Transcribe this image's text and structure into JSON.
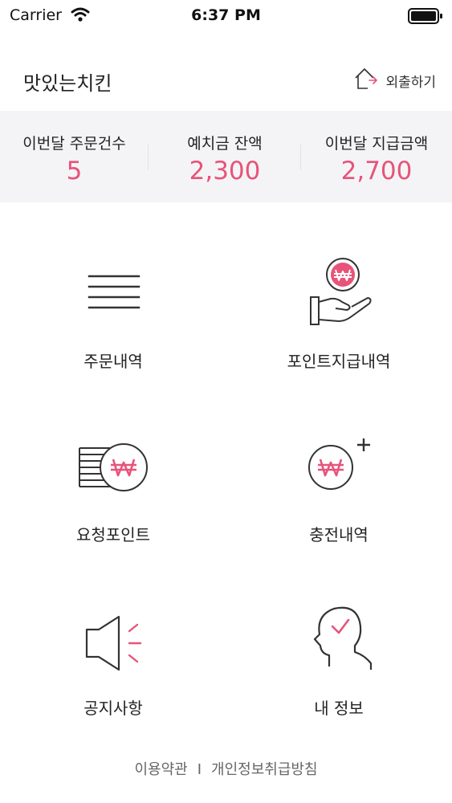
{
  "status_bar": {
    "carrier": "Carrier",
    "time": "6:37 PM"
  },
  "header": {
    "store_name": "맛있는치킨",
    "logout_label": "외출하기"
  },
  "summary": [
    {
      "label": "이번달 주문건수",
      "value": "5"
    },
    {
      "label": "예치금 잔액",
      "value": "2,300"
    },
    {
      "label": "이번달 지급금액",
      "value": "2,700"
    }
  ],
  "menu": [
    {
      "label": "주문내역",
      "icon": "list-icon"
    },
    {
      "label": "포인트지급내역",
      "icon": "hand-coin-icon"
    },
    {
      "label": "요청포인트",
      "icon": "coin-stack-icon"
    },
    {
      "label": "충전내역",
      "icon": "coin-plus-icon"
    },
    {
      "label": "공지사항",
      "icon": "speaker-icon"
    },
    {
      "label": "내 정보",
      "icon": "profile-icon"
    }
  ],
  "footer": {
    "terms": "이용약관",
    "separator": "I",
    "privacy": "개인정보취급방침"
  },
  "colors": {
    "accent": "#e8537a",
    "summary_bg": "#f4f4f6",
    "icon_stroke": "#333333"
  }
}
